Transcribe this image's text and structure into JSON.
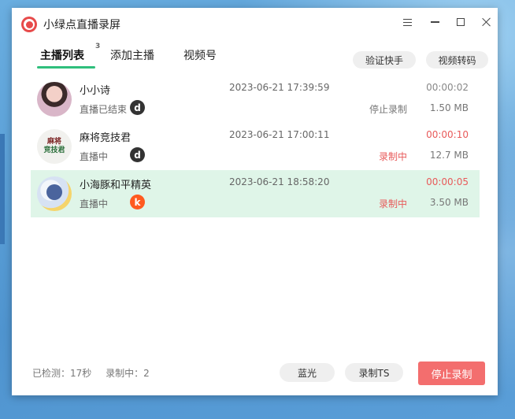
{
  "window": {
    "title": "小绿点直播录屏"
  },
  "tabs": [
    {
      "label": "主播列表",
      "badge": "3",
      "active": true
    },
    {
      "label": "添加主播",
      "active": false
    },
    {
      "label": "视频号",
      "active": false
    }
  ],
  "top_buttons": {
    "verify": "验证快手",
    "convert": "视频转码"
  },
  "streamers": [
    {
      "name": "小小诗",
      "status": "直播已结束",
      "platform_icon": "d",
      "time": "2023-06-21 17:39:59",
      "duration": "00:00:02",
      "action": "停止录制",
      "size": "1.50 MB"
    },
    {
      "name": "麻将竞技君",
      "avatar_text_1": "麻将",
      "avatar_text_2": "竞技君",
      "status": "直播中",
      "platform_icon": "d",
      "time": "2023-06-21 17:00:11",
      "duration": "00:00:10",
      "action": "录制中",
      "size": "12.7 MB"
    },
    {
      "name": "小海豚和平精英",
      "status": "直播中",
      "platform_icon": "k",
      "time": "2023-06-21 18:58:20",
      "duration": "00:00:05",
      "action": "录制中",
      "size": "3.50 MB"
    }
  ],
  "footer": {
    "detected": "已检测：17秒",
    "recording": "录制中：2",
    "bluray": "蓝光",
    "record_ts": "录制TS",
    "stop_record": "停止录制"
  },
  "colors": {
    "accent_green": "#2fbf7c",
    "selected_row": "#dff5e8",
    "recording_red": "#e85a5a",
    "stop_button": "#f36e6e"
  }
}
